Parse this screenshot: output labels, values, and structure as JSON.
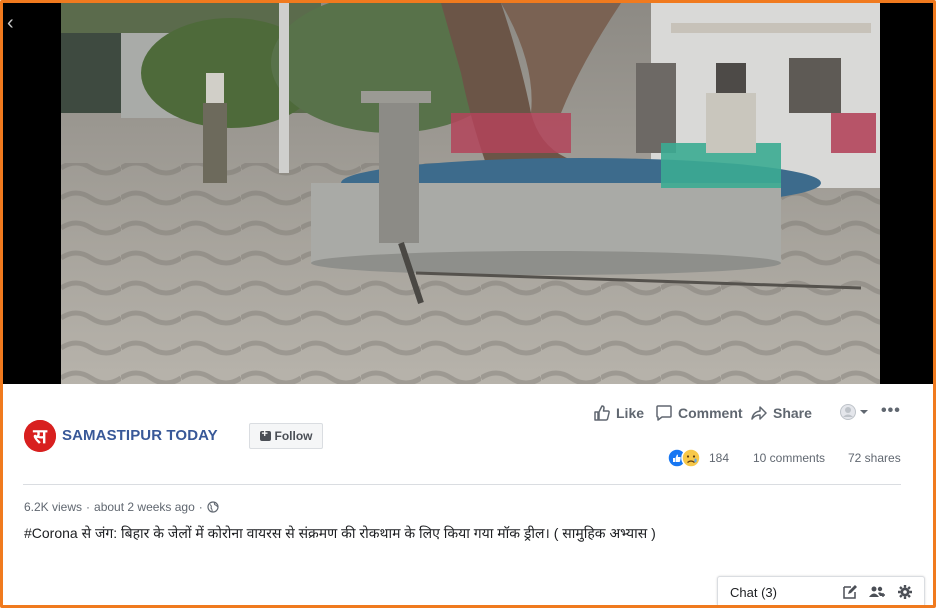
{
  "page": {
    "name": "SAMASTIPUR TODAY",
    "logo_letter": "स",
    "follow_label": "Follow"
  },
  "actions": {
    "like": "Like",
    "comment": "Comment",
    "share": "Share",
    "more": "•••"
  },
  "stats": {
    "reactions": "184",
    "comments": "10 comments",
    "shares": "72 shares"
  },
  "meta": {
    "views": "6.2K views",
    "separator": "·",
    "time": "about 2 weeks ago",
    "separator2": "·"
  },
  "caption": "#Corona से जंग: बिहार के जेलों में कोरोना वायरस से संक्रमण की रोकथाम के लिए किया गया मॉक ड्रील। ( सामुहिक अभ्यास )",
  "chat": {
    "label": "Chat (3)"
  },
  "colors": {
    "frame": "#f07a1e",
    "brand_blue": "#385898",
    "logo_red": "#d8201f"
  }
}
